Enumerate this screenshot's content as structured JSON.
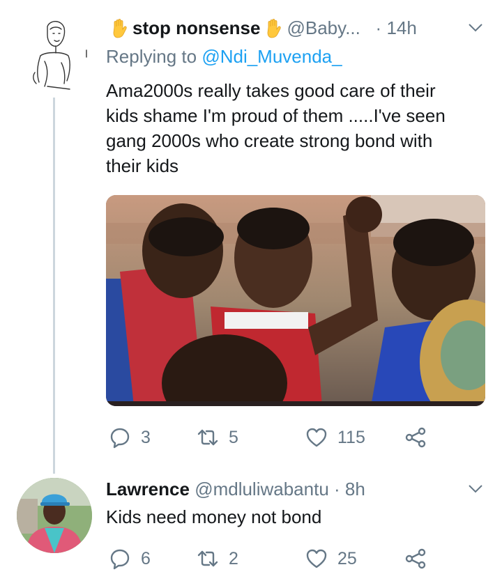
{
  "tweets": [
    {
      "name": "stop nonsense",
      "handle": "@Baby...",
      "time": "14h",
      "replying_label": "Replying to ",
      "replying_to": "@Ndi_Muvenda_",
      "text": "Ama2000s really takes good care of their kids shame I'm proud of them .....I've seen gang 2000s who create strong bond with their kids",
      "replies": "3",
      "retweets": "5",
      "likes": "115",
      "icons": [
        "raised-hand-emoji",
        "chevron-down-icon",
        "reply-icon",
        "retweet-icon",
        "heart-icon",
        "share-icon"
      ]
    },
    {
      "name": "Lawrence",
      "handle": "@mdluliwabantu",
      "time": "8h",
      "text": "Kids need money not bond",
      "replies": "6",
      "retweets": "2",
      "likes": "25"
    }
  ],
  "colors": {
    "accent": "#1da1f2",
    "secondary": "#657786",
    "thread_line": "#ccd6dd"
  }
}
